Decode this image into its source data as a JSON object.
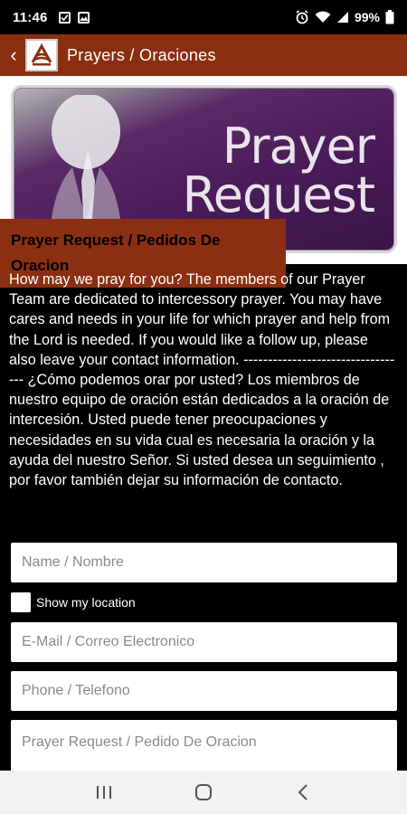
{
  "status_bar": {
    "time": "11:46",
    "battery": "99%",
    "icons_left": [
      "checkbox-notification-icon",
      "image-notification-icon"
    ],
    "icons_right": [
      "alarm-icon",
      "wifi-icon",
      "signal-icon",
      "battery-icon"
    ]
  },
  "app_bar": {
    "title": "Prayers / Oraciones",
    "color": "#8b2f12"
  },
  "banner": {
    "word1": "Prayer",
    "word2": "Request",
    "label": "Prayer Request / Pedidos De Oracion"
  },
  "intro_text": "How may we pray for you? The members of our Prayer Team are dedicated to intercessory prayer. You may have cares and needs in your life for which prayer and help from the Lord is needed. If you would like a follow up, please also leave your contact information. ---------------------------------- ¿Cómo podemos orar por usted? Los miembros de nuestro equipo de oración están dedicados a la oración de intercesión. Usted puede tener preocupaciones y necesidades en su vida cual es necesaria la oración y la ayuda del nuestro Señor. Si usted desea un seguimiento , por favor también dejar su información de contacto.",
  "form": {
    "name_placeholder": "Name / Nombre",
    "show_location_label": "Show my location",
    "email_placeholder": "E-Mail / Correo Electronico",
    "phone_placeholder": "Phone / Telefono",
    "request_placeholder": "Prayer Request / Pedido De Oracion"
  },
  "nav_bar": {
    "buttons": [
      "recent-apps",
      "home",
      "back"
    ]
  }
}
